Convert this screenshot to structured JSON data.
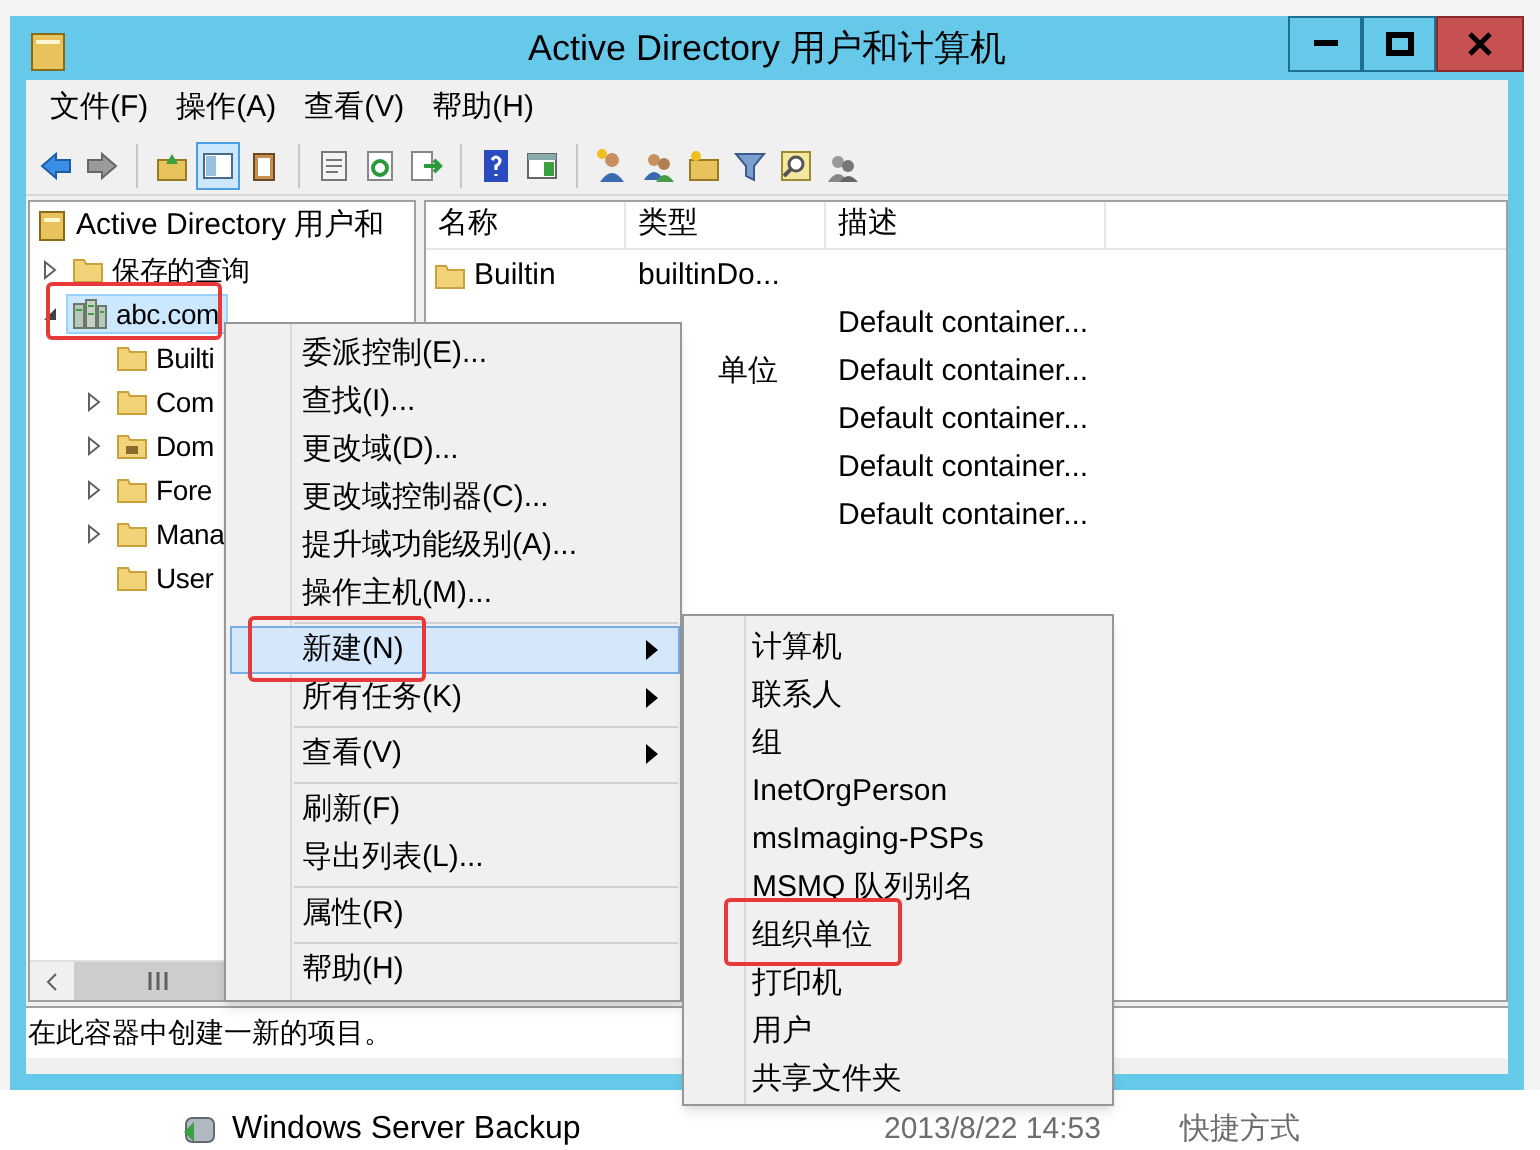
{
  "window": {
    "title": "Active Directory 用户和计算机"
  },
  "menu_bar": [
    "文件(F)",
    "操作(A)",
    "查看(V)",
    "帮助(H)"
  ],
  "toolbar": [
    {
      "kind": "back",
      "pressed": false
    },
    {
      "kind": "forward",
      "pressed": false
    },
    {
      "kind": "separator"
    },
    {
      "kind": "up",
      "pressed": false
    },
    {
      "kind": "tree",
      "pressed": true
    },
    {
      "kind": "clipboard",
      "pressed": false
    },
    {
      "kind": "separator"
    },
    {
      "kind": "properties",
      "pressed": false
    },
    {
      "kind": "refresh",
      "pressed": false
    },
    {
      "kind": "export",
      "pressed": false
    },
    {
      "kind": "separator"
    },
    {
      "kind": "help",
      "pressed": false
    },
    {
      "kind": "console",
      "pressed": false
    },
    {
      "kind": "separator"
    },
    {
      "kind": "user",
      "pressed": false
    },
    {
      "kind": "group",
      "pressed": false
    },
    {
      "kind": "ou",
      "pressed": false
    },
    {
      "kind": "filter",
      "pressed": false
    },
    {
      "kind": "find",
      "pressed": false
    },
    {
      "kind": "delegate",
      "pressed": false
    }
  ],
  "tree": {
    "label": "Active Directory 用户和",
    "kind": "snapin",
    "children": [
      {
        "label": "保存的查询",
        "kind": "folder",
        "has_children": true,
        "expanded": false,
        "selected": false,
        "highlighted": false
      },
      {
        "label": "abc.com",
        "kind": "domain",
        "has_children": true,
        "expanded": true,
        "selected": true,
        "highlighted": true,
        "children": [
          {
            "label": "Builti",
            "kind": "folder",
            "has_children": false,
            "selected": false,
            "highlighted": false
          },
          {
            "label": "Com",
            "kind": "folder",
            "has_children": true,
            "expanded": false,
            "selected": false,
            "highlighted": false
          },
          {
            "label": "Dom",
            "kind": "ou",
            "has_children": true,
            "expanded": false,
            "selected": false,
            "highlighted": false
          },
          {
            "label": "Fore",
            "kind": "folder",
            "has_children": true,
            "expanded": false,
            "selected": false,
            "highlighted": false
          },
          {
            "label": "Mana",
            "kind": "folder",
            "has_children": true,
            "expanded": false,
            "selected": false,
            "highlighted": false
          },
          {
            "label": "User",
            "kind": "folder",
            "has_children": false,
            "selected": false,
            "highlighted": false
          }
        ]
      }
    ]
  },
  "list": {
    "columns": [
      "名称",
      "类型",
      "描述"
    ],
    "rows": [
      {
        "name": "Builtin",
        "kind": "folder",
        "type": "builtinDo..."
      },
      {
        "description": "Default container..."
      },
      {
        "type": "单位",
        "description": "Default container..."
      },
      {
        "description": "Default container..."
      },
      {
        "description": "Default container..."
      },
      {
        "description": "Default container..."
      }
    ]
  },
  "context_menu": [
    {
      "kind": "item",
      "label": "委派控制(E)...",
      "submenu": false,
      "selected": false,
      "highlighted": false
    },
    {
      "kind": "item",
      "label": "查找(I)...",
      "submenu": false,
      "selected": false,
      "highlighted": false
    },
    {
      "kind": "item",
      "label": "更改域(D)...",
      "submenu": false,
      "selected": false,
      "highlighted": false
    },
    {
      "kind": "item",
      "label": "更改域控制器(C)...",
      "submenu": false,
      "selected": false,
      "highlighted": false
    },
    {
      "kind": "item",
      "label": "提升域功能级别(A)...",
      "submenu": false,
      "selected": false,
      "highlighted": false
    },
    {
      "kind": "item",
      "label": "操作主机(M)...",
      "submenu": false,
      "selected": false,
      "highlighted": false
    },
    {
      "kind": "separator"
    },
    {
      "kind": "item",
      "label": "新建(N)",
      "submenu": true,
      "selected": true,
      "highlighted": true
    },
    {
      "kind": "item",
      "label": "所有任务(K)",
      "submenu": true,
      "selected": false,
      "highlighted": false
    },
    {
      "kind": "separator"
    },
    {
      "kind": "item",
      "label": "查看(V)",
      "submenu": true,
      "selected": false,
      "highlighted": false
    },
    {
      "kind": "separator"
    },
    {
      "kind": "item",
      "label": "刷新(F)",
      "submenu": false,
      "selected": false,
      "highlighted": false
    },
    {
      "kind": "item",
      "label": "导出列表(L)...",
      "submenu": false,
      "selected": false,
      "highlighted": false
    },
    {
      "kind": "separator"
    },
    {
      "kind": "item",
      "label": "属性(R)",
      "submenu": false,
      "selected": false,
      "highlighted": false
    },
    {
      "kind": "separator"
    },
    {
      "kind": "item",
      "label": "帮助(H)",
      "submenu": false,
      "selected": false,
      "highlighted": false
    }
  ],
  "submenu": [
    {
      "label": "计算机",
      "highlighted": false
    },
    {
      "label": "联系人",
      "highlighted": false
    },
    {
      "label": "组",
      "highlighted": false
    },
    {
      "label": "InetOrgPerson",
      "highlighted": false
    },
    {
      "label": "msImaging-PSPs",
      "highlighted": false
    },
    {
      "label": "MSMQ 队列别名",
      "highlighted": false
    },
    {
      "label": "组织单位",
      "highlighted": true
    },
    {
      "label": "打印机",
      "highlighted": false
    },
    {
      "label": "用户",
      "highlighted": false
    },
    {
      "label": "共享文件夹",
      "highlighted": false
    }
  ],
  "status_bar": "在此容器中创建一新的项目。",
  "background_list": [
    {
      "name": "Windows Server Backup",
      "date": "2013/8/22 14:53",
      "type": "快捷方式"
    }
  ]
}
